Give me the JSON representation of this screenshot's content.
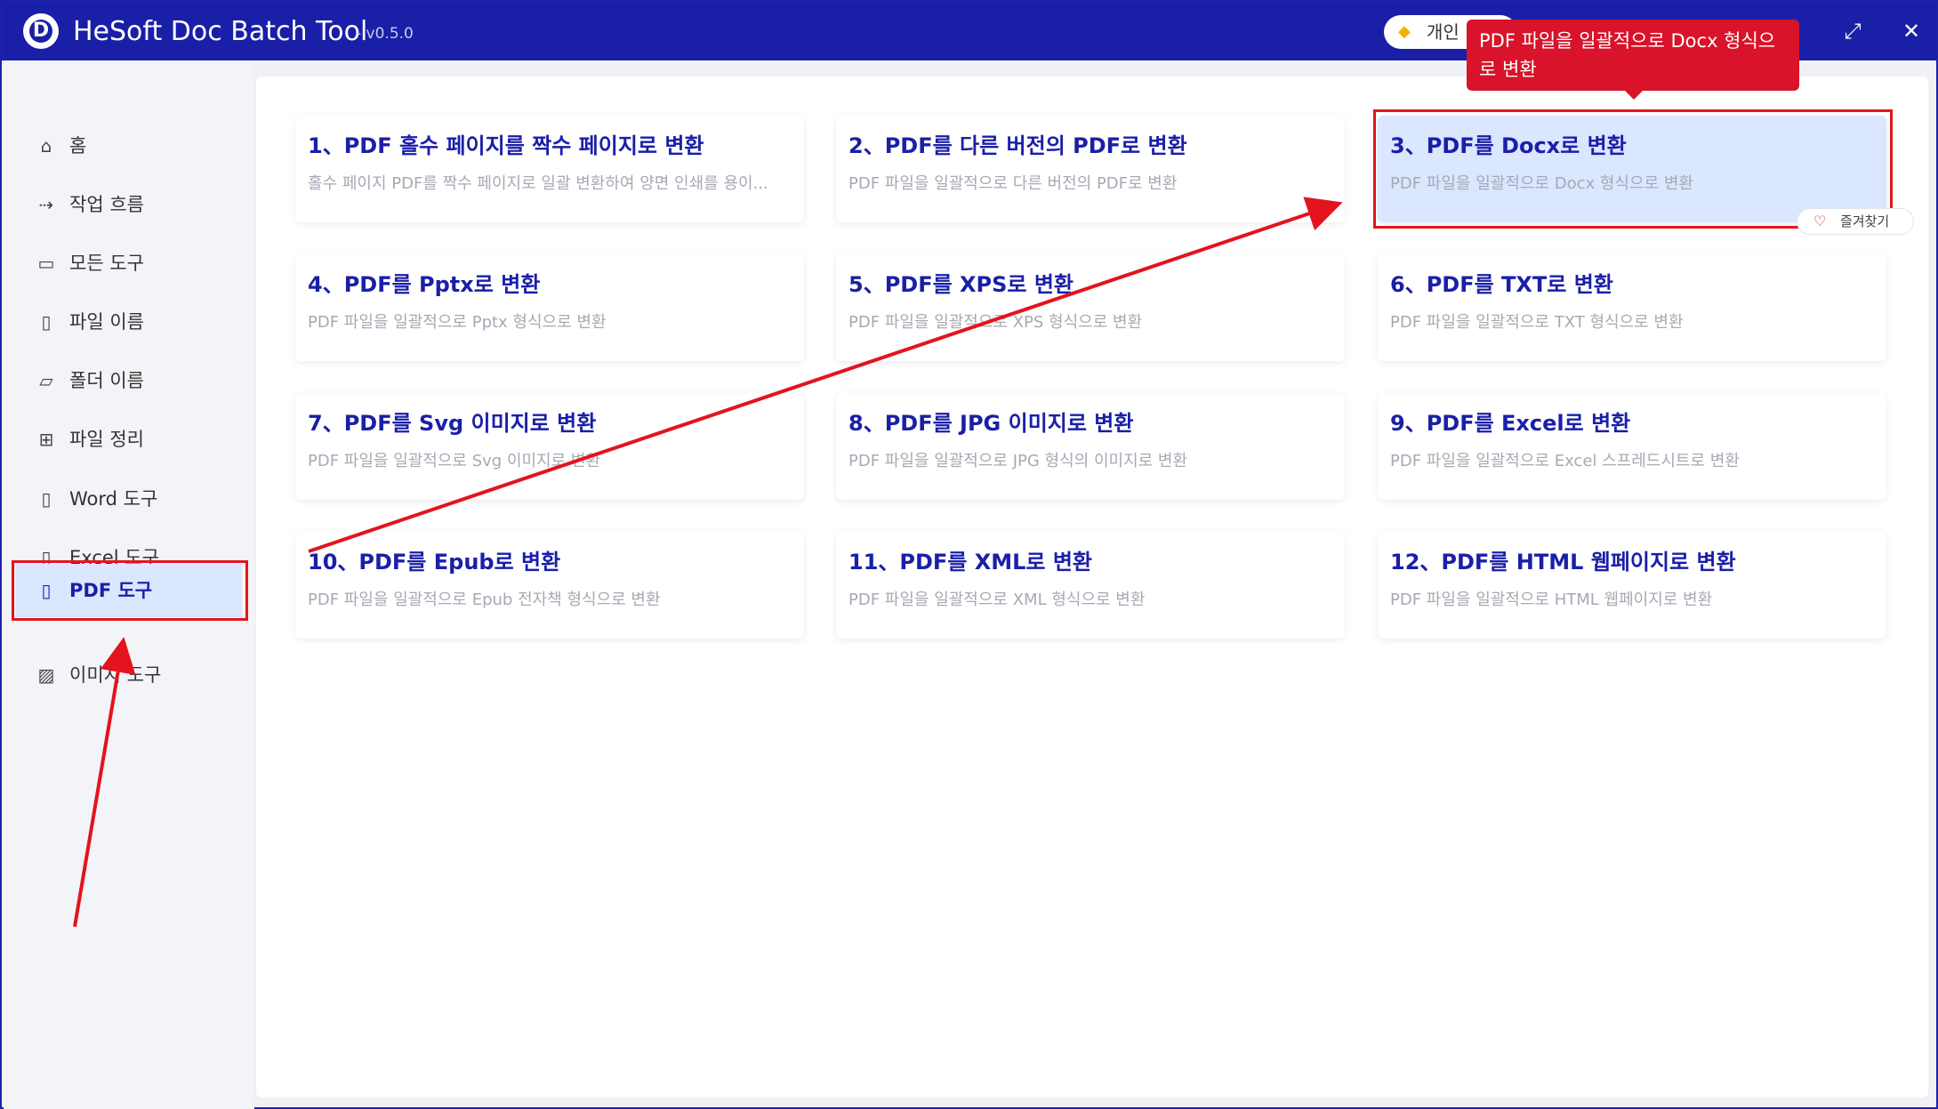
{
  "titlebar": {
    "logo_letter": "D",
    "title": "HeSoft Doc Batch Tool",
    "version": "- v0.5.0",
    "license": "개인",
    "maximize_glyph": "⤢",
    "close_glyph": "✕"
  },
  "sidebar": {
    "items": [
      {
        "label": "홈",
        "icon": "home-icon",
        "glyph": "⌂"
      },
      {
        "label": "작업 흐름",
        "icon": "workflow-icon",
        "glyph": "⇢"
      },
      {
        "label": "모든 도구",
        "icon": "monitor-icon",
        "glyph": "▭"
      },
      {
        "label": "파일 이름",
        "icon": "file-icon",
        "glyph": "▯"
      },
      {
        "label": "폴더 이름",
        "icon": "folder-icon",
        "glyph": "▱"
      },
      {
        "label": "파일 정리",
        "icon": "organize-icon",
        "glyph": "⊞"
      },
      {
        "label": "Word 도구",
        "icon": "word-file-icon",
        "glyph": "▯"
      },
      {
        "label": "Excel 도구",
        "icon": "excel-file-icon",
        "glyph": "▯"
      },
      {
        "label": "PDF 도구",
        "icon": "pdf-file-icon",
        "glyph": "▯"
      },
      {
        "label": "이미지 도구",
        "icon": "image-icon",
        "glyph": "▨"
      }
    ],
    "active_index": 8
  },
  "cards": [
    {
      "title": "1、PDF 홀수 페이지를 짝수 페이지로 변환",
      "desc": "홀수 페이지 PDF를 짝수 페이지로 일괄 변환하여 양면 인쇄를 용이..."
    },
    {
      "title": "2、PDF를 다른 버전의 PDF로 변환",
      "desc": "PDF 파일을 일괄적으로 다른 버전의 PDF로 변환"
    },
    {
      "title": "3、PDF를 Docx로 변환",
      "desc": "PDF 파일을 일괄적으로 Docx 형식으로 변환"
    },
    {
      "title": "4、PDF를 Pptx로 변환",
      "desc": "PDF 파일을 일괄적으로 Pptx 형식으로 변환"
    },
    {
      "title": "5、PDF를 XPS로 변환",
      "desc": "PDF 파일을 일괄적으로 XPS 형식으로 변환"
    },
    {
      "title": "6、PDF를 TXT로 변환",
      "desc": "PDF 파일을 일괄적으로 TXT 형식으로 변환"
    },
    {
      "title": "7、PDF를 Svg 이미지로 변환",
      "desc": "PDF 파일을 일괄적으로 Svg 이미지로 변환"
    },
    {
      "title": "8、PDF를 JPG 이미지로 변환",
      "desc": "PDF 파일을 일괄적으로 JPG 형식의 이미지로 변환"
    },
    {
      "title": "9、PDF를 Excel로 변환",
      "desc": "PDF 파일을 일괄적으로 Excel 스프레드시트로 변환"
    },
    {
      "title": "10、PDF를 Epub로 변환",
      "desc": "PDF 파일을 일괄적으로 Epub 전자책 형식으로 변환"
    },
    {
      "title": "11、PDF를 XML로 변환",
      "desc": "PDF 파일을 일괄적으로 XML 형식으로 변환"
    },
    {
      "title": "12、PDF를 HTML 웹페이지로 변환",
      "desc": "PDF 파일을 일괄적으로 HTML 웹페이지로 변환"
    }
  ],
  "selected_card_index": 2,
  "favorite": {
    "label": "즐겨찾기",
    "heart": "♡"
  },
  "tooltip": {
    "text": "PDF 파일을 일괄적으로 Docx 형식으로 변환"
  },
  "colors": {
    "accent": "#1a1fa8",
    "highlight_red": "#e3141e",
    "selected_bg": "#dbe6ff"
  }
}
